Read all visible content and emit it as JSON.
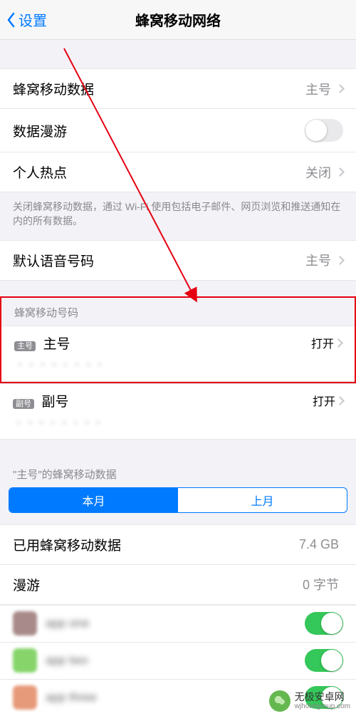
{
  "nav": {
    "back": "设置",
    "title": "蜂窝移动网络"
  },
  "group1": {
    "data": {
      "label": "蜂窝移动数据",
      "value": "主号"
    },
    "roam": {
      "label": "数据漫游",
      "on": false
    },
    "hotspot": {
      "label": "个人热点",
      "value": "关闭"
    },
    "footer": "关闭蜂窝移动数据，通过 Wi-Fi 使用包括电子邮件、网页浏览和推送通知在内的所有数据。"
  },
  "voice": {
    "label": "默认语音号码",
    "value": "主号"
  },
  "numbers": {
    "header": "蜂窝移动号码",
    "primary": {
      "tag": "主号",
      "name": "主号",
      "detail": "・・・・・・・・",
      "status": "打开"
    },
    "secondary": {
      "tag": "副号",
      "name": "副号",
      "detail": "・・・・・・・・",
      "status": "打开"
    }
  },
  "usage": {
    "header": "\"主号\"的蜂窝移动数据",
    "seg_this": "本月",
    "seg_last": "上月",
    "used": {
      "label": "已用蜂窝移动数据",
      "value": "7.4 GB"
    },
    "roam": {
      "label": "漫游",
      "value": "0 字节"
    }
  },
  "apps": [
    {
      "name": "app one",
      "on": true,
      "color": "#a88a8a"
    },
    {
      "name": "app two",
      "on": true,
      "color": "#86d46a"
    },
    {
      "name": "app three",
      "on": true,
      "color": "#e79a7a"
    }
  ],
  "watermark": {
    "name": "无极安卓网",
    "sub": "wjhotelgroup.com"
  }
}
